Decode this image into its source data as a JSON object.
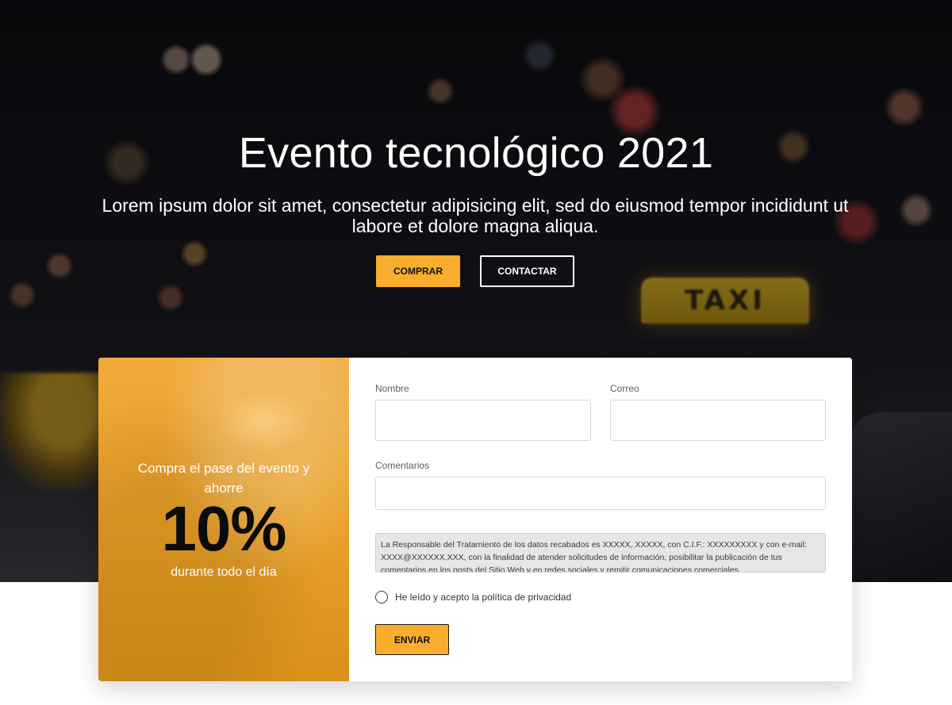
{
  "hero": {
    "title": "Evento tecnológico 2021",
    "subtitle": "Lorem ipsum dolor sit amet, consectetur adipisicing elit, sed do eiusmod tempor incididunt ut labore et dolore magna aliqua.",
    "background_sign_text": "TAXI",
    "buy_button": "COMPRAR",
    "contact_button": "CONTACTAR"
  },
  "promo": {
    "line1": "Compra el pase del evento y ahorre",
    "discount": "10%",
    "line3": "durante todo el día"
  },
  "form": {
    "name_label": "Nombre",
    "name_value": "",
    "email_label": "Correo",
    "email_value": "",
    "comments_label": "Comentarios",
    "comments_value": "",
    "privacy_text": "La Responsable del Tratamiento de los datos recabados es XXXXX, XXXXX, con C.I.F.: XXXXXXXXX y con e-mail: XXXX@XXXXXX.XXX, con la finalidad de atender solicitudes de información, posibilitar la publicación de tus comentarios en los posts del Sitio Web y en redes sociales y remitir comunicaciones comerciales.",
    "consent_label": "He leído y acepto la política de privacidad",
    "submit_button": "ENVIAR"
  },
  "colors": {
    "accent": "#f8ae2c",
    "promo_bg": "#eaa232",
    "text_dark": "#111111"
  }
}
